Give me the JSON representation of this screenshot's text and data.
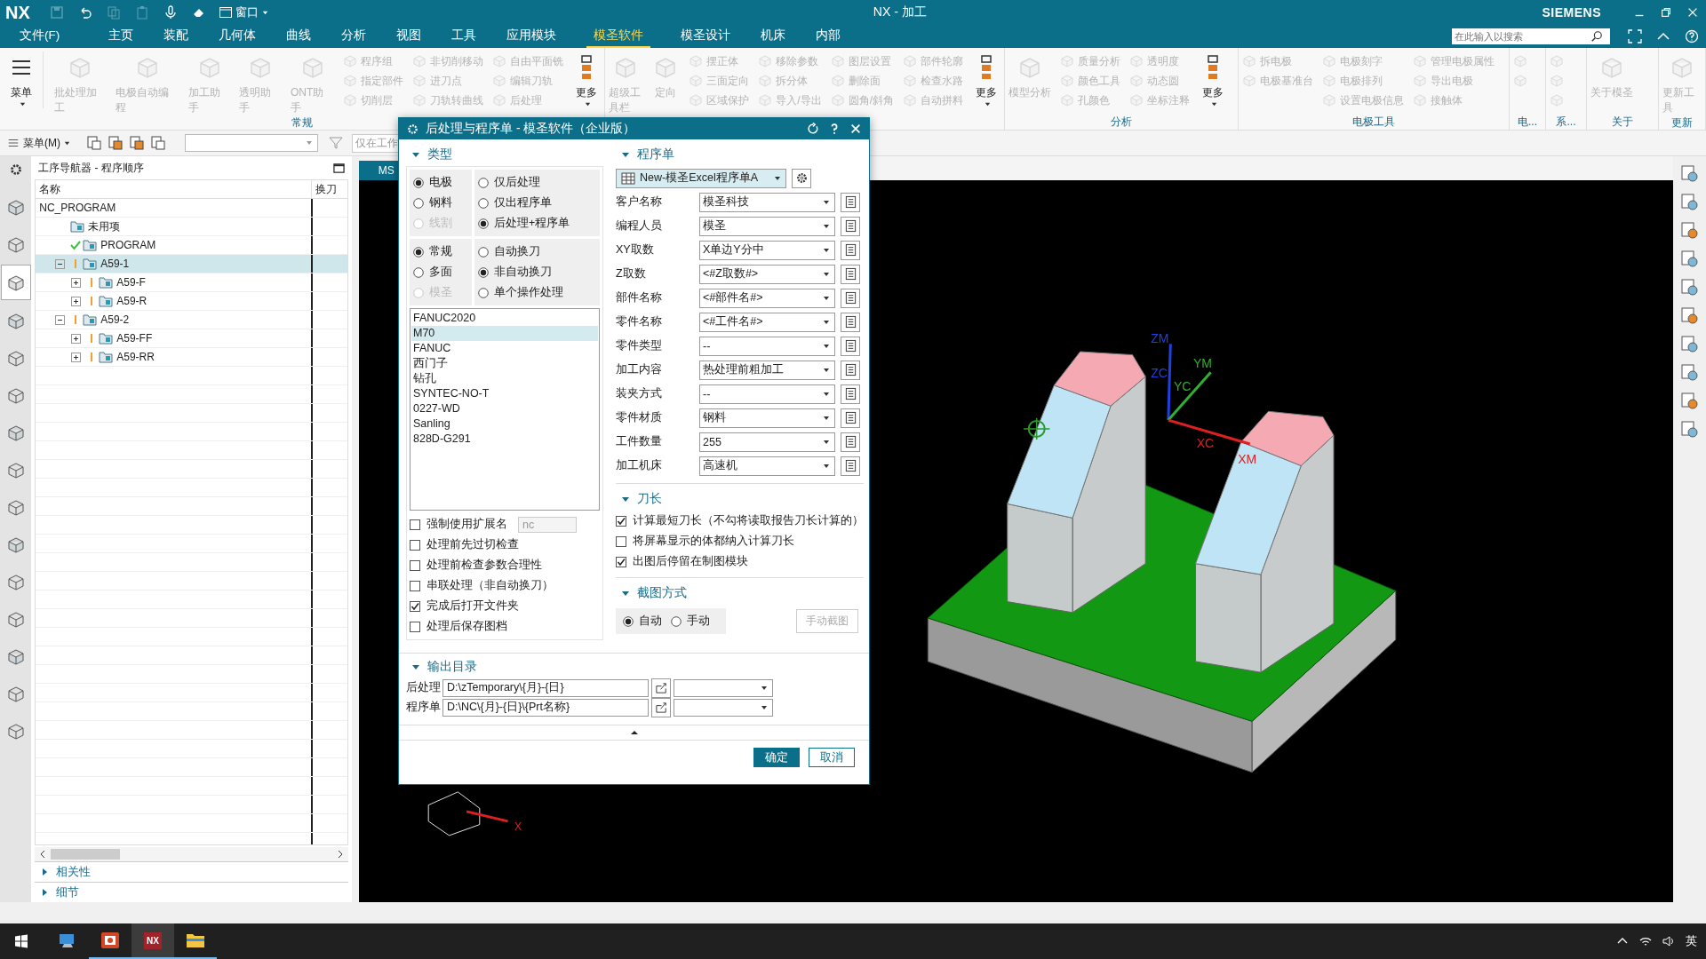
{
  "app": {
    "logo": "NX",
    "window_menu": "窗口",
    "title": "NX - 加工",
    "brand": "SIEMENS",
    "search": {
      "placeholder": "在此输入以搜索"
    }
  },
  "menu_tabs": [
    {
      "label": "文件(F)",
      "selected": false
    },
    {
      "label": "主页",
      "selected": false
    },
    {
      "label": "装配",
      "selected": false
    },
    {
      "label": "几何体",
      "selected": false
    },
    {
      "label": "曲线",
      "selected": false
    },
    {
      "label": "分析",
      "selected": false
    },
    {
      "label": "视图",
      "selected": false
    },
    {
      "label": "工具",
      "selected": false
    },
    {
      "label": "应用模块",
      "selected": false
    },
    {
      "label": "模圣软件",
      "selected": true
    },
    {
      "label": "模圣设计",
      "selected": false
    },
    {
      "label": "机床",
      "selected": false
    },
    {
      "label": "内部",
      "selected": false
    }
  ],
  "ribbon": {
    "menu_button": "菜单",
    "groups": [
      {
        "label": "常规",
        "items": [
          {
            "kind": "large",
            "label": "批处理加工",
            "disabled": true
          },
          {
            "kind": "large",
            "label": "电极自动编程",
            "disabled": true
          },
          {
            "kind": "large",
            "label": "加工助手",
            "disabled": true
          },
          {
            "kind": "large",
            "label": "透明助手",
            "disabled": true
          },
          {
            "kind": "large",
            "label": "ONT助手",
            "disabled": true
          },
          {
            "kind": "stack",
            "entries": [
              {
                "label": "程序组",
                "disabled": true
              },
              {
                "label": "指定部件",
                "disabled": true
              },
              {
                "label": "切削层",
                "disabled": true
              }
            ]
          },
          {
            "kind": "stack",
            "entries": [
              {
                "label": "非切削移动",
                "disabled": true
              },
              {
                "label": "进刀点",
                "disabled": true
              },
              {
                "label": "刀轨转曲线",
                "disabled": true
              }
            ]
          },
          {
            "kind": "stack",
            "entries": [
              {
                "label": "自由平面铣",
                "disabled": true
              },
              {
                "label": "编辑刀轨",
                "disabled": true
              },
              {
                "label": "后处理",
                "disabled": true
              }
            ]
          },
          {
            "kind": "more",
            "label": "更多",
            "disabled": false
          }
        ]
      },
      {
        "items": [
          {
            "kind": "large",
            "label": "超级工具栏",
            "disabled": true
          },
          {
            "kind": "large",
            "label": "定向",
            "disabled": true
          },
          {
            "kind": "stack",
            "entries": [
              {
                "label": "摆正体",
                "disabled": true
              },
              {
                "label": "三面定向",
                "disabled": true
              },
              {
                "label": "区域保护",
                "disabled": true
              }
            ]
          },
          {
            "kind": "stack",
            "entries": [
              {
                "label": "移除参数",
                "disabled": true
              },
              {
                "label": "拆分体",
                "disabled": true
              },
              {
                "label": "导入/导出",
                "disabled": true
              }
            ]
          },
          {
            "kind": "stack",
            "entries": [
              {
                "label": "图层设置",
                "disabled": true
              },
              {
                "label": "删除面",
                "disabled": true
              },
              {
                "label": "圆角/斜角",
                "disabled": true
              }
            ]
          },
          {
            "kind": "stack",
            "entries": [
              {
                "label": "部件轮廓",
                "disabled": true
              },
              {
                "label": "检查水路",
                "disabled": true
              },
              {
                "label": "自动拼料",
                "disabled": true
              }
            ]
          },
          {
            "kind": "more",
            "label": "更多",
            "disabled": false
          }
        ]
      },
      {
        "label": "分析",
        "items": [
          {
            "kind": "large",
            "label": "模型分析",
            "disabled": true
          },
          {
            "kind": "stack",
            "entries": [
              {
                "label": "质量分析",
                "disabled": true
              },
              {
                "label": "颜色工具",
                "disabled": true
              },
              {
                "label": "孔颜色",
                "disabled": true
              }
            ]
          },
          {
            "kind": "stack",
            "entries": [
              {
                "label": "透明度",
                "disabled": true
              },
              {
                "label": "动态圆",
                "disabled": true
              },
              {
                "label": "坐标注释",
                "disabled": true
              }
            ]
          },
          {
            "kind": "more",
            "label": "更多",
            "disabled": false
          }
        ]
      },
      {
        "label": "电极工具",
        "items": [
          {
            "kind": "stack",
            "entries": [
              {
                "label": "拆电极",
                "disabled": true
              },
              {
                "label": "电极基准台",
                "disabled": true
              }
            ]
          },
          {
            "kind": "stack",
            "entries": [
              {
                "label": "电极刻字",
                "disabled": true
              },
              {
                "label": "电极排列",
                "disabled": true
              },
              {
                "label": "设置电极信息",
                "disabled": true
              }
            ]
          },
          {
            "kind": "stack",
            "entries": [
              {
                "label": "管理电极属性",
                "disabled": true
              },
              {
                "label": "导出电极",
                "disabled": true
              },
              {
                "label": "接触体",
                "disabled": true
              }
            ]
          }
        ]
      },
      {
        "label": "电...",
        "items": [
          {
            "kind": "stack",
            "entries": [
              {
                "disabled": true
              },
              {
                "disabled": true
              }
            ]
          }
        ]
      },
      {
        "label": "系...",
        "items": [
          {
            "kind": "stack",
            "entries": [
              {
                "disabled": true
              },
              {
                "disabled": true
              },
              {
                "disabled": true
              }
            ]
          }
        ]
      },
      {
        "label": "关于",
        "items": [
          {
            "kind": "large",
            "label": "关于模圣",
            "disabled": true
          }
        ]
      },
      {
        "label": "更新",
        "items": [
          {
            "kind": "large",
            "label": "更新工具",
            "disabled": true
          }
        ]
      }
    ]
  },
  "toolbar": {
    "menu": "菜单(M)",
    "filter_field": "仅在工作"
  },
  "left_bar": [
    {
      "selected": false
    },
    {
      "selected": false
    },
    {
      "selected": true
    },
    {
      "selected": false
    },
    {
      "selected": false
    },
    {
      "selected": false
    },
    {
      "selected": false
    },
    {
      "selected": false
    },
    {
      "selected": false
    },
    {
      "selected": false
    },
    {
      "selected": false
    },
    {
      "selected": false
    },
    {
      "selected": false
    },
    {
      "selected": false
    },
    {
      "selected": false
    }
  ],
  "navigator": {
    "title": "工序导航器 - 程序顺序",
    "columns": [
      "名称",
      "换刀"
    ],
    "tree": [
      {
        "label": "NC_PROGRAM",
        "kind": "root",
        "selected": false,
        "children": [
          {
            "label": "未用项",
            "kind": "plain",
            "selected": false
          },
          {
            "label": "PROGRAM",
            "kind": "done",
            "selected": false
          },
          {
            "label": "A59-1",
            "kind": "pending",
            "selected": true,
            "expanded": true,
            "children": [
              {
                "label": "A59-F",
                "kind": "pending",
                "selected": false,
                "expanded": false
              },
              {
                "label": "A59-R",
                "kind": "pending",
                "selected": false,
                "expanded": false
              }
            ]
          },
          {
            "label": "A59-2",
            "kind": "pending",
            "selected": false,
            "expanded": true,
            "children": [
              {
                "label": "A59-FF",
                "kind": "pending",
                "selected": false,
                "expanded": false
              },
              {
                "label": "A59-RR",
                "kind": "pending",
                "selected": false,
                "expanded": false
              }
            ]
          }
        ]
      }
    ],
    "panels": [
      {
        "label": "相关性",
        "expanded": false
      },
      {
        "label": "细节",
        "expanded": false
      }
    ]
  },
  "viewport": {
    "tab": "MS",
    "axis_labels": [
      {
        "label": "ZM"
      },
      {
        "label": "ZC"
      },
      {
        "label": "YM"
      },
      {
        "label": "YC"
      },
      {
        "label": "XC"
      },
      {
        "label": "XM"
      }
    ],
    "triad_label": "X"
  },
  "dialog": {
    "title": "后处理与程序单 - 模圣软件（企业版）",
    "type_section": {
      "title": "类型",
      "expanded": true,
      "material": [
        {
          "label": "电极",
          "selected": true,
          "disabled": false
        },
        {
          "label": "钢料",
          "selected": false,
          "disabled": false
        },
        {
          "label": "线割",
          "selected": false,
          "disabled": true
        }
      ],
      "output_mode": [
        {
          "label": "仅后处理",
          "selected": false,
          "disabled": false
        },
        {
          "label": "仅出程序单",
          "selected": false,
          "disabled": false
        },
        {
          "label": "后处理+程序单",
          "selected": true,
          "disabled": false
        }
      ],
      "process": [
        {
          "label": "常规",
          "selected": true,
          "disabled": false
        },
        {
          "label": "多面",
          "selected": false,
          "disabled": false
        },
        {
          "label": "模圣",
          "selected": false,
          "disabled": true
        }
      ],
      "tool_change": [
        {
          "label": "自动换刀",
          "selected": false,
          "disabled": false
        },
        {
          "label": "非自动换刀",
          "selected": true,
          "disabled": false
        },
        {
          "label": "单个操作处理",
          "selected": false,
          "disabled": false
        }
      ],
      "posts": [
        {
          "label": "FANUC2020",
          "selected": false
        },
        {
          "label": "M70",
          "selected": true
        },
        {
          "label": "FANUC",
          "selected": false
        },
        {
          "label": "西门子",
          "selected": false
        },
        {
          "label": "钻孔",
          "selected": false
        },
        {
          "label": "SYNTEC-NO-T",
          "selected": false
        },
        {
          "label": "0227-WD",
          "selected": false
        },
        {
          "label": "Sanling",
          "selected": false
        },
        {
          "label": "828D-G291",
          "selected": false
        }
      ],
      "extension": {
        "label": "强制使用扩展名",
        "checked": false,
        "value": "nc",
        "field_disabled": true
      },
      "options": [
        {
          "label": "处理前先过切检查",
          "checked": false
        },
        {
          "label": "处理前检查参数合理性",
          "checked": false
        },
        {
          "label": "串联处理（非自动换刀）",
          "checked": false
        },
        {
          "label": "完成后打开文件夹",
          "checked": true
        },
        {
          "label": "处理后保存图档",
          "checked": false
        }
      ]
    },
    "sheet_section": {
      "title": "程序单",
      "expanded": true,
      "template": "New-模圣Excel程序单A",
      "fields": [
        {
          "label": "客户名称",
          "value": "模圣科技"
        },
        {
          "label": "编程人员",
          "value": "模圣"
        },
        {
          "label": "XY取数",
          "value": "X单边Y分中"
        },
        {
          "label": "Z取数",
          "value": "<#Z取数#>"
        },
        {
          "label": "部件名称",
          "value": "<#部件名#>"
        },
        {
          "label": "零件名称",
          "value": "<#工件名#>"
        },
        {
          "label": "零件类型",
          "value": "--"
        },
        {
          "label": "加工内容",
          "value": "热处理前粗加工"
        },
        {
          "label": "装夹方式",
          "value": "--"
        },
        {
          "label": "零件材质",
          "value": "钢料"
        },
        {
          "label": "工件数量",
          "value": "255"
        },
        {
          "label": "加工机床",
          "value": "高速机"
        }
      ]
    },
    "tool_section": {
      "title": "刀长",
      "expanded": true,
      "options": [
        {
          "label": "计算最短刀长（不勾将读取报告刀长计算的）",
          "checked": true
        },
        {
          "label": "将屏幕显示的体都纳入计算刀长",
          "checked": false
        },
        {
          "label": "出图后停留在制图模块",
          "checked": true
        }
      ]
    },
    "capture_section": {
      "title": "截图方式",
      "expanded": true,
      "modes": [
        {
          "label": "自动",
          "selected": true
        },
        {
          "label": "手动",
          "selected": false
        }
      ],
      "button": {
        "label": "手动截图",
        "disabled": true
      }
    },
    "output_section": {
      "title": "输出目录",
      "expanded": true,
      "rows": [
        {
          "label": "后处理",
          "value": "D:\\zTemporary\\{月}-{日}"
        },
        {
          "label": "程序单",
          "value": "D:\\NC\\{月}-{日}\\{Prt名称}"
        }
      ]
    },
    "buttons": [
      {
        "label": "确定",
        "kind": "primary"
      },
      {
        "label": "取消",
        "kind": "secondary"
      }
    ]
  },
  "taskbar": {
    "apps": [
      {
        "kind": "computer",
        "running": false,
        "selected": false
      },
      {
        "kind": "slides",
        "running": true,
        "selected": false
      },
      {
        "kind": "nx",
        "label": "NX",
        "running": true,
        "selected": true
      },
      {
        "kind": "folder",
        "running": true,
        "selected": false
      }
    ],
    "ime": "英"
  }
}
